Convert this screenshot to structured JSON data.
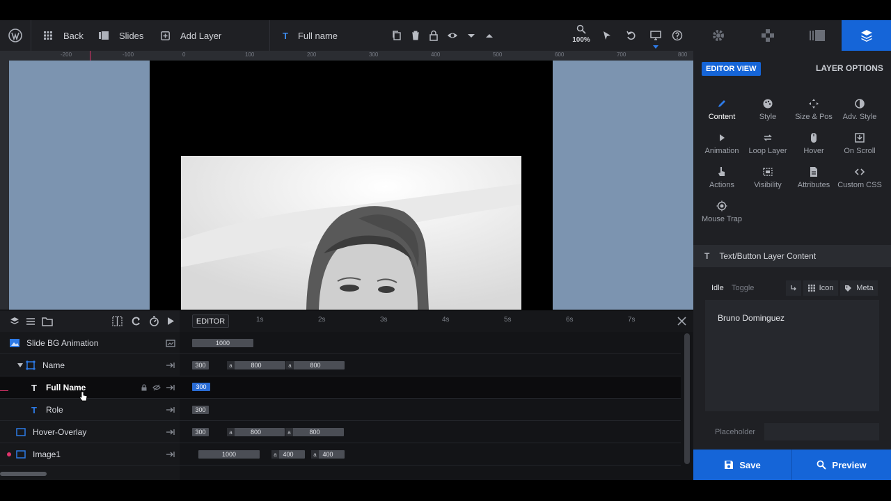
{
  "toolbar": {
    "back": "Back",
    "slides": "Slides",
    "add_layer": "Add Layer",
    "layer_name": "Full name",
    "zoom": "100%"
  },
  "ruler": {
    "ticks": [
      "-200",
      "-100",
      "0",
      "100",
      "200",
      "300",
      "400",
      "500",
      "600",
      "700",
      "800"
    ]
  },
  "timeline": {
    "editor_label": "EDITOR",
    "seconds": [
      "1s",
      "2s",
      "3s",
      "4s",
      "5s",
      "6s",
      "7s"
    ],
    "layers": [
      {
        "name": "Slide BG Animation",
        "bars": [
          "1000"
        ]
      },
      {
        "name": "Name",
        "bars": [
          "300",
          "800",
          "800"
        ],
        "a": [
          "a",
          "a"
        ]
      },
      {
        "name": "Full Name",
        "bars": [
          "300"
        ]
      },
      {
        "name": "Role",
        "bars": [
          "300"
        ]
      },
      {
        "name": "Hover-Overlay",
        "bars": [
          "300",
          "800",
          "800"
        ],
        "a": [
          "a",
          "a"
        ]
      },
      {
        "name": "Image1",
        "bars": [
          "1000",
          "400",
          "400"
        ],
        "a": [
          "a",
          "a"
        ]
      }
    ]
  },
  "panel": {
    "editor_view": "EDITOR VIEW",
    "layer_options": "LAYER OPTIONS",
    "options": [
      "Content",
      "Style",
      "Size & Pos",
      "Adv. Style",
      "Animation",
      "Loop Layer",
      "Hover",
      "On Scroll",
      "Actions",
      "Visibility",
      "Attributes",
      "Custom CSS",
      "Mouse Trap"
    ],
    "section_title": "Text/Button Layer Content",
    "tab_idle": "Idle",
    "tab_toggle": "Toggle",
    "icon_label": "Icon",
    "meta_label": "Meta",
    "content_text": "Bruno Dominguez",
    "placeholder_label": "Placeholder",
    "save": "Save",
    "preview": "Preview"
  },
  "colors": {
    "accent": "#1565d8",
    "canvas_bg": "#7c94b0",
    "toolbar_bg": "#1f2024"
  }
}
